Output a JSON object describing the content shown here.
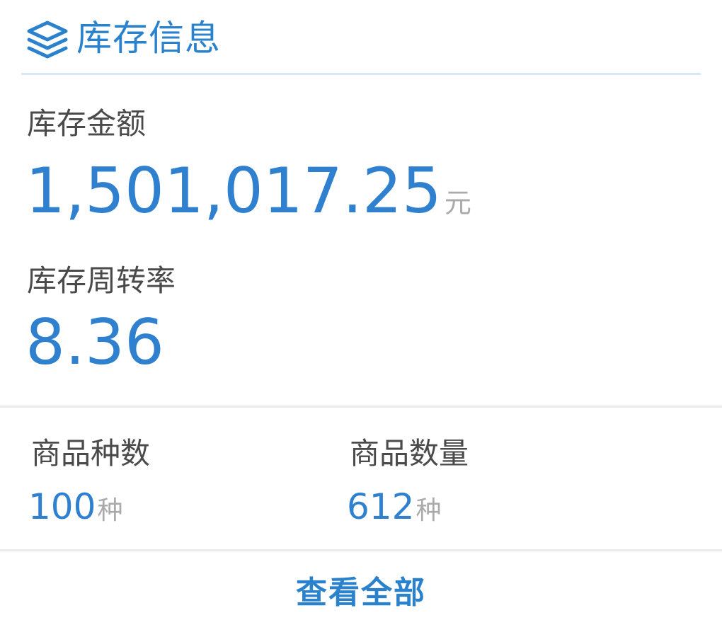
{
  "header": {
    "title": "库存信息",
    "icon": "layers-icon",
    "accent_color": "#2b82cc"
  },
  "inventory_amount": {
    "label": "库存金额",
    "value": "1,501,017.25",
    "unit": "元"
  },
  "turnover_rate": {
    "label": "库存周转率",
    "value": "8.36"
  },
  "product_kinds": {
    "label": "商品种数",
    "value": "100",
    "unit": "种"
  },
  "product_quantity": {
    "label": "商品数量",
    "value": "612",
    "unit": "种"
  },
  "footer": {
    "view_all_label": "查看全部"
  }
}
